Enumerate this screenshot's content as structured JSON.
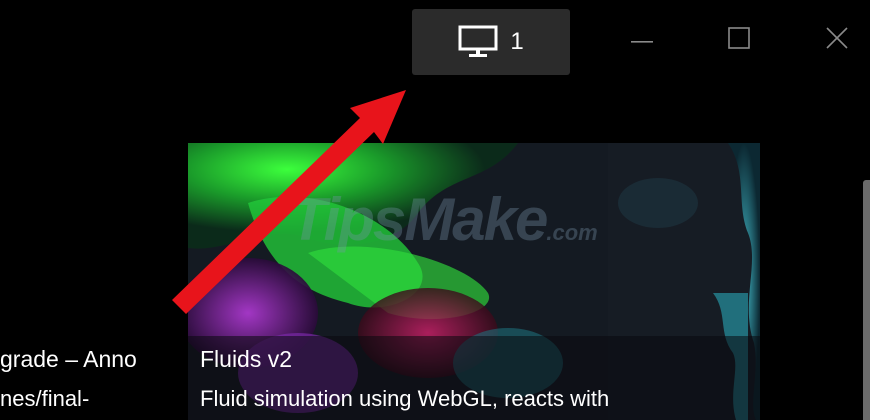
{
  "titlebar": {
    "monitor_icon": "monitor-icon",
    "monitor_count": "1",
    "minimize_icon": "minimize-icon",
    "maximize_icon": "maximize-icon",
    "close_icon": "close-icon"
  },
  "gallery": {
    "left_card": {
      "title": "grade – Anno",
      "subtitle": "nes/final-"
    },
    "main_card": {
      "title": "Fluids v2",
      "description": "Fluid simulation using WebGL, reacts with"
    }
  },
  "watermark": {
    "text": "TipsMake",
    "suffix": ".com"
  },
  "colors": {
    "background": "#000000",
    "button_bg": "#2b2b2b",
    "arrow": "#e8141b"
  }
}
